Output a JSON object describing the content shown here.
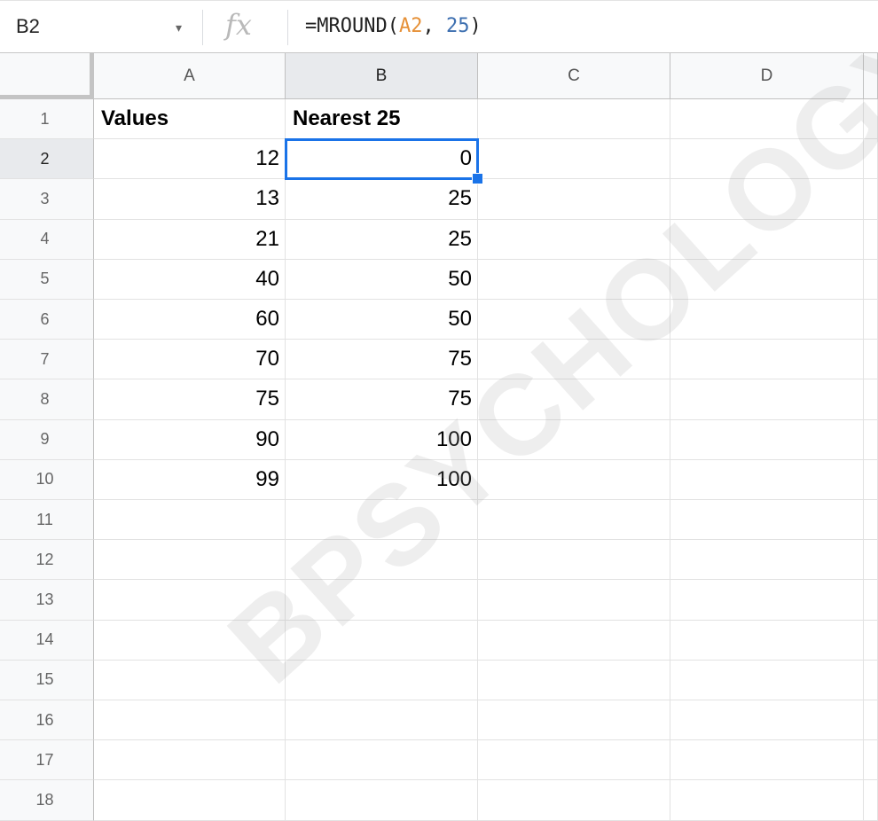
{
  "formula_bar": {
    "name_box": "B2",
    "fx_label": "fx",
    "formula_parts": [
      {
        "text": "=MROUND(",
        "kind": "fn"
      },
      {
        "text": "A2",
        "kind": "ref"
      },
      {
        "text": ", ",
        "kind": "fn"
      },
      {
        "text": "25",
        "kind": "num"
      },
      {
        "text": ")",
        "kind": "fn"
      }
    ]
  },
  "columns": [
    "A",
    "B",
    "C",
    "D"
  ],
  "selected_column": "B",
  "row_numbers": [
    "1",
    "2",
    "3",
    "4",
    "5",
    "6",
    "7",
    "8",
    "9",
    "10",
    "11",
    "12",
    "13",
    "14",
    "15",
    "16",
    "17",
    "18"
  ],
  "selected_row": "2",
  "rows": [
    {
      "A": "Values",
      "B": "Nearest 25"
    },
    {
      "A": "12",
      "B": "0"
    },
    {
      "A": "13",
      "B": "25"
    },
    {
      "A": "21",
      "B": "25"
    },
    {
      "A": "40",
      "B": "50"
    },
    {
      "A": "60",
      "B": "50"
    },
    {
      "A": "70",
      "B": "75"
    },
    {
      "A": "75",
      "B": "75"
    },
    {
      "A": "90",
      "B": "100"
    },
    {
      "A": "99",
      "B": "100"
    }
  ],
  "active_cell": "B2",
  "watermark": "BPSYCHOLOGY.C",
  "colors": {
    "accent": "#1a73e8",
    "ref": "#e69138",
    "num": "#3d6fb0"
  }
}
